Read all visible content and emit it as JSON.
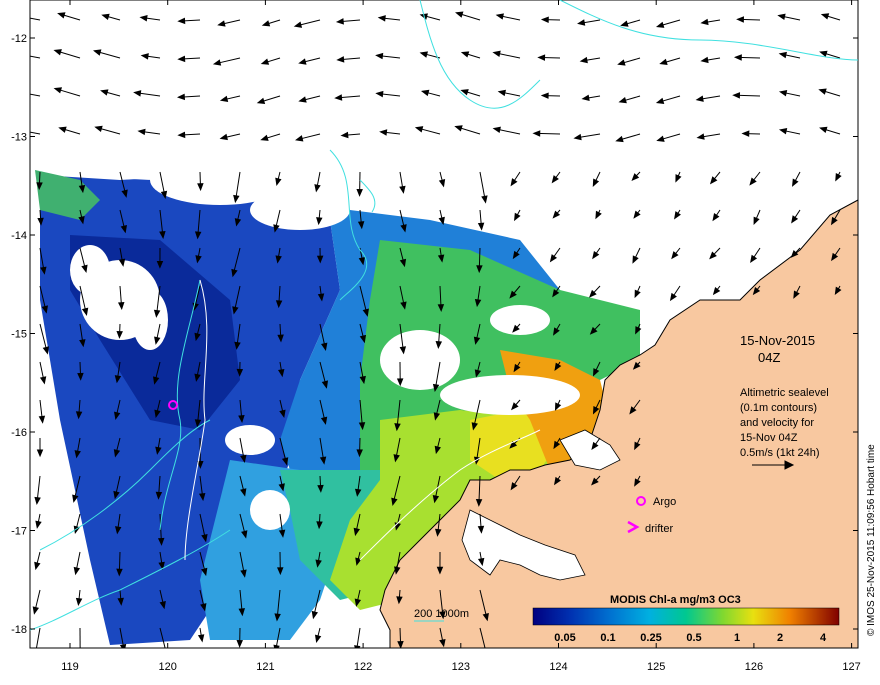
{
  "map": {
    "date_title": "15-Nov-2015",
    "time_title": "04Z",
    "info_lines": [
      "Altimetric sealevel",
      "(0.1m contours)",
      "and velocity for",
      "15-Nov 04Z",
      "0.5m/s (1kt 24h)"
    ],
    "legend_argo": "Argo",
    "legend_drifter": "drifter",
    "depth_label": "200  1000m",
    "colorbar_title": "MODIS Chl-a mg/m3 OC3",
    "colorbar_ticks": [
      "0.05",
      "0.1",
      "0.25",
      "0.5",
      "1",
      "2",
      "4"
    ],
    "credit": "© IMOS 25-Nov-2015 11:09:56 Hobart time",
    "lat_labels": [
      "-12",
      "-13",
      "-14",
      "-15",
      "-16",
      "-17",
      "-18"
    ],
    "lon_labels": [
      "119",
      "120",
      "121",
      "122",
      "123",
      "124",
      "125",
      "126",
      "127"
    ],
    "colors": {
      "land": "#f8c8a0",
      "contour": "#40e0e0",
      "argo": "#ff00ff",
      "colorbar": [
        "#000080",
        "#0040c0",
        "#0090d8",
        "#00c8a0",
        "#60d040",
        "#d0e020",
        "#f8a000",
        "#e04000",
        "#900000"
      ]
    }
  }
}
